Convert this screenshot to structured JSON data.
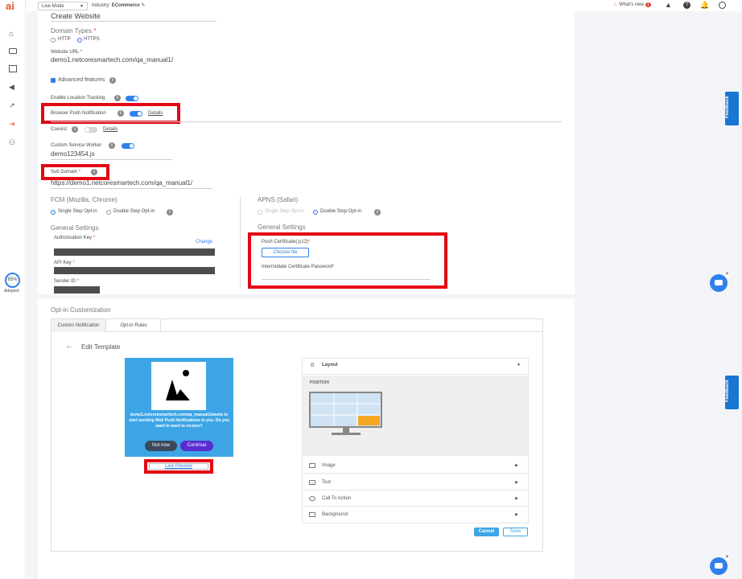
{
  "top": {
    "logo": "ai",
    "mode_select": "Live Mode",
    "industry_label": "Industry:",
    "industry_value": "ECommerce",
    "whats_new": "What's new",
    "whats_new_count": "1"
  },
  "left": {
    "adopted_pct": "85%",
    "adopted_label": "Adopted"
  },
  "website": {
    "title": "Create Website",
    "domain_types_label": "Domain Types",
    "http": "HTTP",
    "https": "HTTPS",
    "url_label": "Website URL",
    "url_value": "demo1.netcoresmartech.com/qa_manual1/",
    "advanced": "Advanced features",
    "location": "Enable Location Tracking",
    "bpn": "Browser Push Notification",
    "details": "Details",
    "coexist": "Coexist",
    "coexist_details": "Details",
    "csw_label": "Custom Service Worker",
    "csw_value": "demo123454.js",
    "subdomain_label": "Sub Domain",
    "subdomain_value": "https://demo1.netcoresmartech.com/qa_manual1/",
    "fcm_title": "FCM (Mozilla, Chrome)",
    "single_opt": "Single Step Opt-in",
    "double_opt": "Double Step Opt-in",
    "general": "General Settings",
    "auth_key": "Authorisation Key",
    "change": "Change",
    "api_key": "API Key",
    "sender_id": "Sender ID",
    "apns_title": "APNS (Safari)",
    "apns_single": "Single Step Opt-in",
    "apns_double": "Double Step Opt-in",
    "apns_general": "General Settings",
    "push_cert": "Push Certificate(.p12)",
    "choose_file": "Choose file",
    "icp": "Intermidiate Certificate Password"
  },
  "optin": {
    "title": "Opt-in Customization",
    "tabs": [
      "Custom Notification",
      "Opt-in Rules"
    ],
    "edit_template": "Edit Template",
    "preview_text": "demo1.netcoresmartech.com/qa_manual1/wants to start sending Web Push Notifications to you. Do you want to want to receive?",
    "not_now": "Not now",
    "continue": "Continue",
    "live_preview": "Live Preview",
    "layout": "Layout",
    "position": "POSITION",
    "menu": [
      "Image",
      "Text",
      "Call To Action",
      "Background"
    ],
    "cancel": "Cancel",
    "save": "Save"
  },
  "feedback": "Feedback"
}
